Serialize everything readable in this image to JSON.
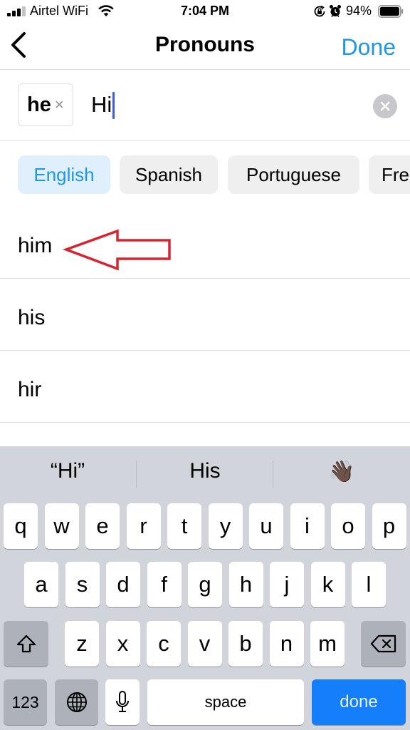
{
  "status_bar": {
    "carrier": "Airtel WiFi",
    "signal_bars_filled": 3,
    "signal_bars_total": 4,
    "time": "7:04 PM",
    "battery_percent": "94%",
    "icons": [
      "signal-icon",
      "wifi-icon",
      "orientation-lock-icon",
      "alarm-icon",
      "battery-icon"
    ]
  },
  "header": {
    "title": "Pronouns",
    "done_label": "Done",
    "back_icon": "chevron-left-icon"
  },
  "search": {
    "token_label": "he",
    "token_remove_glyph": "×",
    "value": "Hi",
    "clear_icon": "clear-circle-icon"
  },
  "languages": [
    {
      "label": "English",
      "selected": true
    },
    {
      "label": "Spanish",
      "selected": false
    },
    {
      "label": "Portuguese",
      "selected": false
    },
    {
      "label": "Fre",
      "selected": false
    }
  ],
  "results": [
    {
      "label": "him"
    },
    {
      "label": "his"
    },
    {
      "label": "hir"
    }
  ],
  "annotation": {
    "type": "arrow",
    "points_to": "him",
    "color": "#d9232e"
  },
  "keyboard": {
    "suggestions": [
      "“Hi”",
      "His",
      "👋🏿"
    ],
    "row1": [
      "q",
      "w",
      "e",
      "r",
      "t",
      "y",
      "u",
      "i",
      "o",
      "p"
    ],
    "row2": [
      "a",
      "s",
      "d",
      "f",
      "g",
      "h",
      "j",
      "k",
      "l"
    ],
    "row3": [
      "z",
      "x",
      "c",
      "v",
      "b",
      "n",
      "m"
    ],
    "numbers_label": "123",
    "space_label": "space",
    "done_label": "done",
    "accent_color": "#147efb"
  },
  "colors": {
    "accent": "#2196e8",
    "chip_selected_bg": "#dff0fc",
    "chip_bg": "#efefef",
    "keyboard_bg": "#d1d4db"
  }
}
